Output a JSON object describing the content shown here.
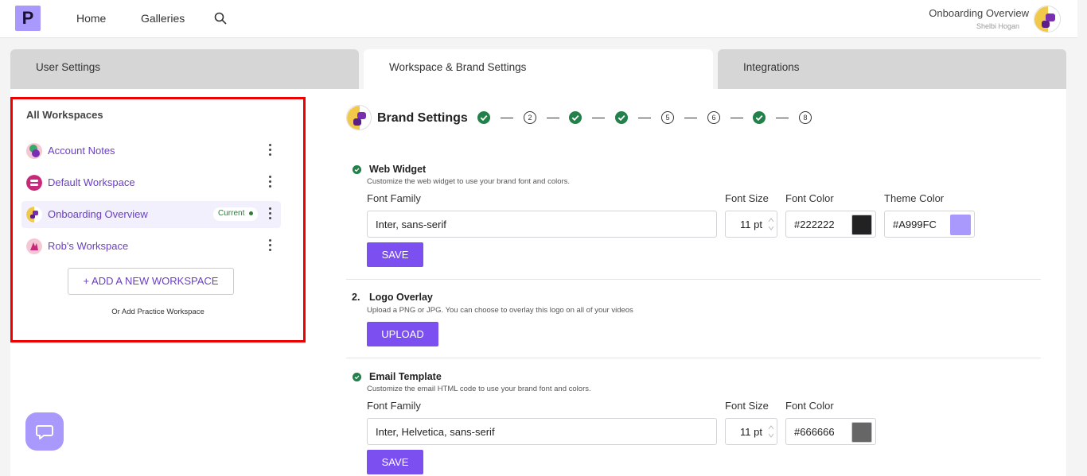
{
  "header": {
    "logo_letter": "P",
    "nav": [
      "Home",
      "Galleries"
    ],
    "profile_title": "Onboarding Overview",
    "profile_user": "Shelbi Hogan"
  },
  "tabs": [
    {
      "label": "User Settings",
      "active": false
    },
    {
      "label": "Workspace & Brand Settings",
      "active": true
    },
    {
      "label": "Integrations",
      "active": false
    }
  ],
  "sidebar": {
    "title": "All Workspaces",
    "workspaces": [
      {
        "name": "Account Notes",
        "current": false
      },
      {
        "name": "Default Workspace",
        "current": false
      },
      {
        "name": "Onboarding Overview",
        "current": true,
        "badge": "Current"
      },
      {
        "name": "Rob's Workspace",
        "current": false
      }
    ],
    "add_label": "+ ADD A NEW WORKSPACE",
    "practice_label": "Or Add Practice Workspace"
  },
  "brand": {
    "title": "Brand Settings",
    "steps": [
      {
        "label": "",
        "done": true
      },
      {
        "label": "2",
        "done": false
      },
      {
        "label": "",
        "done": true
      },
      {
        "label": "",
        "done": true
      },
      {
        "label": "5",
        "done": false
      },
      {
        "label": "6",
        "done": false
      },
      {
        "label": "",
        "done": true
      },
      {
        "label": "8",
        "done": false
      }
    ]
  },
  "web_widget": {
    "title": "Web Widget",
    "desc": "Customize the web widget to use your brand font and colors.",
    "font_family_label": "Font Family",
    "font_family": "Inter, sans-serif",
    "font_size_label": "Font Size",
    "font_size": "11 pt",
    "font_color_label": "Font Color",
    "font_color": "#222222",
    "theme_color_label": "Theme Color",
    "theme_color": "#A999FC",
    "save": "SAVE"
  },
  "logo_overlay": {
    "number": "2.",
    "title": "Logo Overlay",
    "desc": "Upload a PNG or JPG. You can choose to overlay this logo on all of your videos",
    "upload": "UPLOAD"
  },
  "email_template": {
    "title": "Email Template",
    "desc": "Customize the email HTML code to use your brand font and colors.",
    "font_family_label": "Font Family",
    "font_family": "Inter, Helvetica, sans-serif",
    "font_size_label": "Font Size",
    "font_size": "11 pt",
    "font_color_label": "Font Color",
    "font_color": "#666666",
    "save": "SAVE"
  },
  "colors": {
    "accent": "#7C4FF0",
    "brand_light": "#A999FC",
    "success": "#22804A",
    "highlight_border": "#EE0000"
  },
  "icons": [
    "search-icon",
    "more-vertical-icon",
    "check-icon",
    "chat-icon"
  ]
}
